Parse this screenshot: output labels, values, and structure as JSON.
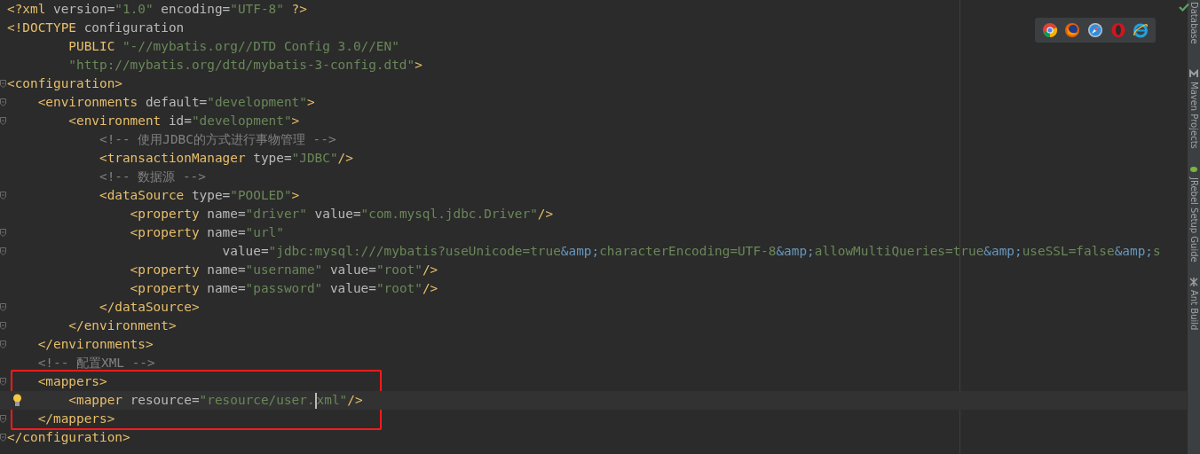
{
  "editor": {
    "lines": [
      {
        "fold": false,
        "tokens": [
          {
            "kind": "tag",
            "text": "<?xml"
          },
          {
            "kind": "attr",
            "text": " version="
          },
          {
            "kind": "value",
            "text": "\"1.0\""
          },
          {
            "kind": "attr",
            "text": " encoding="
          },
          {
            "kind": "value",
            "text": "\"UTF-8\""
          },
          {
            "kind": "tag",
            "text": " ?>"
          }
        ]
      },
      {
        "fold": false,
        "tokens": [
          {
            "kind": "tag",
            "text": "<!DOCTYPE"
          },
          {
            "kind": "attr",
            "text": " configuration"
          }
        ]
      },
      {
        "fold": false,
        "tokens": [
          {
            "kind": "tag",
            "text": "        PUBLIC"
          },
          {
            "kind": "value",
            "text": " \"-//mybatis.org//DTD Config 3.0//EN\""
          }
        ]
      },
      {
        "fold": false,
        "tokens": [
          {
            "kind": "value",
            "text": "        \"http://mybatis.org/dtd/mybatis-3-config.dtd\""
          },
          {
            "kind": "tag",
            "text": ">"
          }
        ]
      },
      {
        "fold": true,
        "tokens": [
          {
            "kind": "tag",
            "text": "<configuration>"
          }
        ]
      },
      {
        "fold": true,
        "tokens": [
          {
            "kind": "tag",
            "text": "    <environments"
          },
          {
            "kind": "attr",
            "text": " default="
          },
          {
            "kind": "value",
            "text": "\"development\""
          },
          {
            "kind": "tag",
            "text": ">"
          }
        ]
      },
      {
        "fold": true,
        "tokens": [
          {
            "kind": "tag",
            "text": "        <environment"
          },
          {
            "kind": "attr",
            "text": " id="
          },
          {
            "kind": "value",
            "text": "\"development\""
          },
          {
            "kind": "tag",
            "text": ">"
          }
        ]
      },
      {
        "fold": false,
        "tokens": [
          {
            "kind": "comment",
            "text": "            <!-- 使用JDBC的方式进行事物管理 -->"
          }
        ]
      },
      {
        "fold": false,
        "tokens": [
          {
            "kind": "tag",
            "text": "            <transactionManager"
          },
          {
            "kind": "attr",
            "text": " type="
          },
          {
            "kind": "value",
            "text": "\"JDBC\""
          },
          {
            "kind": "tag",
            "text": "/>"
          }
        ]
      },
      {
        "fold": false,
        "tokens": [
          {
            "kind": "comment",
            "text": "            <!-- 数据源 -->"
          }
        ]
      },
      {
        "fold": true,
        "tokens": [
          {
            "kind": "tag",
            "text": "            <dataSource"
          },
          {
            "kind": "attr",
            "text": " type="
          },
          {
            "kind": "value",
            "text": "\"POOLED\""
          },
          {
            "kind": "tag",
            "text": ">"
          }
        ]
      },
      {
        "fold": false,
        "tokens": [
          {
            "kind": "tag",
            "text": "                <property"
          },
          {
            "kind": "attr",
            "text": " name="
          },
          {
            "kind": "value",
            "text": "\"driver\""
          },
          {
            "kind": "attr",
            "text": " value="
          },
          {
            "kind": "value",
            "text": "\"com.mysql.jdbc.Driver\""
          },
          {
            "kind": "tag",
            "text": "/>"
          }
        ]
      },
      {
        "fold": true,
        "tokens": [
          {
            "kind": "tag",
            "text": "                <property"
          },
          {
            "kind": "attr",
            "text": " name="
          },
          {
            "kind": "value",
            "text": "\"url\""
          }
        ]
      },
      {
        "fold": true,
        "tokens": [
          {
            "kind": "attr",
            "text": "                            value="
          },
          {
            "kind": "value",
            "text": "\"jdbc:mysql:///mybatis?useUnicode=true"
          },
          {
            "kind": "entity",
            "text": "&amp;"
          },
          {
            "kind": "value",
            "text": "characterEncoding=UTF-8"
          },
          {
            "kind": "entity",
            "text": "&amp;"
          },
          {
            "kind": "value",
            "text": "allowMultiQueries=true"
          },
          {
            "kind": "entity",
            "text": "&amp;"
          },
          {
            "kind": "value",
            "text": "useSSL=false"
          },
          {
            "kind": "entity",
            "text": "&amp;"
          },
          {
            "kind": "value",
            "text": "s"
          }
        ]
      },
      {
        "fold": false,
        "tokens": [
          {
            "kind": "tag",
            "text": "                <property"
          },
          {
            "kind": "attr",
            "text": " name="
          },
          {
            "kind": "value",
            "text": "\"username\""
          },
          {
            "kind": "attr",
            "text": " value="
          },
          {
            "kind": "value",
            "text": "\"root\""
          },
          {
            "kind": "tag",
            "text": "/>"
          }
        ]
      },
      {
        "fold": false,
        "tokens": [
          {
            "kind": "tag",
            "text": "                <property"
          },
          {
            "kind": "attr",
            "text": " name="
          },
          {
            "kind": "value",
            "text": "\"password\""
          },
          {
            "kind": "attr",
            "text": " value="
          },
          {
            "kind": "value",
            "text": "\"root\""
          },
          {
            "kind": "tag",
            "text": "/>"
          }
        ]
      },
      {
        "fold": true,
        "tokens": [
          {
            "kind": "tag",
            "text": "            </dataSource>"
          }
        ]
      },
      {
        "fold": true,
        "tokens": [
          {
            "kind": "tag",
            "text": "        </environment>"
          }
        ]
      },
      {
        "fold": true,
        "tokens": [
          {
            "kind": "tag",
            "text": "    </environments>"
          }
        ]
      },
      {
        "fold": false,
        "tokens": [
          {
            "kind": "comment",
            "text": "    <!-- 配置XML -->"
          }
        ]
      },
      {
        "fold": true,
        "marked": true,
        "tokens": [
          {
            "kind": "tag",
            "text": "    <mappers>"
          }
        ]
      },
      {
        "fold": false,
        "marked": true,
        "current": true,
        "bulb": true,
        "tokens": [
          {
            "kind": "tag",
            "text": "        <mapper"
          },
          {
            "kind": "attr",
            "text": " resource="
          },
          {
            "kind": "value",
            "text": "\"resource/user."
          },
          {
            "kind": "value",
            "text": "xml\"",
            "caret": true
          },
          {
            "kind": "tag",
            "text": "/>"
          }
        ]
      },
      {
        "fold": true,
        "marked": true,
        "tokens": [
          {
            "kind": "tag",
            "text": "    </mappers>"
          }
        ]
      },
      {
        "fold": true,
        "tokens": [
          {
            "kind": "tag",
            "text": "</configuration>"
          }
        ]
      }
    ]
  },
  "tool_windows": [
    {
      "label": "Database",
      "kind": "database"
    },
    {
      "label": "Maven Projects",
      "kind": "maven"
    },
    {
      "label": "JRebel Setup Guide",
      "kind": "jrebel"
    },
    {
      "label": "Ant Build",
      "kind": "ant"
    }
  ]
}
